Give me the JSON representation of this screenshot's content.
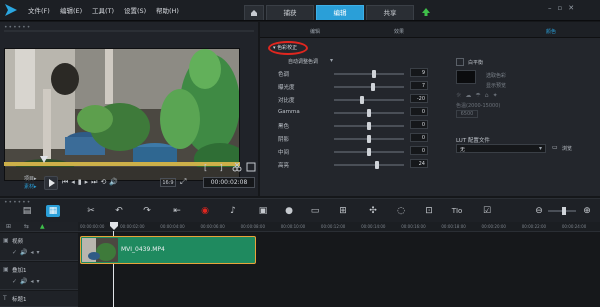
{
  "menu": {
    "items": [
      "文件(F)",
      "编辑(E)",
      "工具(T)",
      "设置(S)",
      "帮助(H)"
    ]
  },
  "workspace_tabs": [
    {
      "label": "捕获"
    },
    {
      "label": "编辑",
      "active": true
    },
    {
      "label": "共享"
    }
  ],
  "preview": {
    "mode_labels": [
      "项目▸",
      "素材▸"
    ],
    "timecode": "00:00:02:08",
    "zoom": "16:9"
  },
  "options": {
    "subtabs": [
      "编辑",
      "效果",
      "颜色"
    ],
    "section_title": "色彩校正",
    "white_balance_label": "自动调整色调",
    "sliders": [
      {
        "label": "色调",
        "value": "9"
      },
      {
        "label": "曝光度",
        "value": "7"
      },
      {
        "label": "对比度",
        "value": "-20"
      },
      {
        "label": "Gamma",
        "value": "0"
      },
      {
        "label": "黑色",
        "value": "0"
      },
      {
        "label": "阴影",
        "value": "0"
      },
      {
        "label": "中间",
        "value": "0"
      },
      {
        "label": "高亮",
        "value": "24"
      }
    ],
    "right_controls": {
      "white_balance": "白平衡",
      "pick_color": "选取色彩",
      "show_preview": "显示预览",
      "scene_label": "色温(2000-15000)",
      "scene_value": "6500"
    },
    "lut": {
      "label": "LUT 配置文件",
      "value": "无",
      "browse": "浏览"
    }
  },
  "timeline": {
    "ruler_marks": [
      "00:00:00:00",
      "00:00:02:00",
      "00:00:04:00",
      "00:00:06:00",
      "00:00:08:00",
      "00:00:10:00",
      "00:00:12:00",
      "00:00:14:00",
      "00:00:16:00",
      "00:00:18:00",
      "00:00:20:00",
      "00:00:22:00",
      "00:00:24:00"
    ],
    "tracks": [
      {
        "name": "视频"
      },
      {
        "name": "叠加1"
      },
      {
        "name": "标题1"
      }
    ],
    "clip_name": "MVI_0439.MP4"
  },
  "colors": {
    "accent": "#2a9fd8",
    "clip": "#1f8a5f",
    "clip_border": "#e8a33a",
    "highlight_circle": "#e0261f"
  }
}
